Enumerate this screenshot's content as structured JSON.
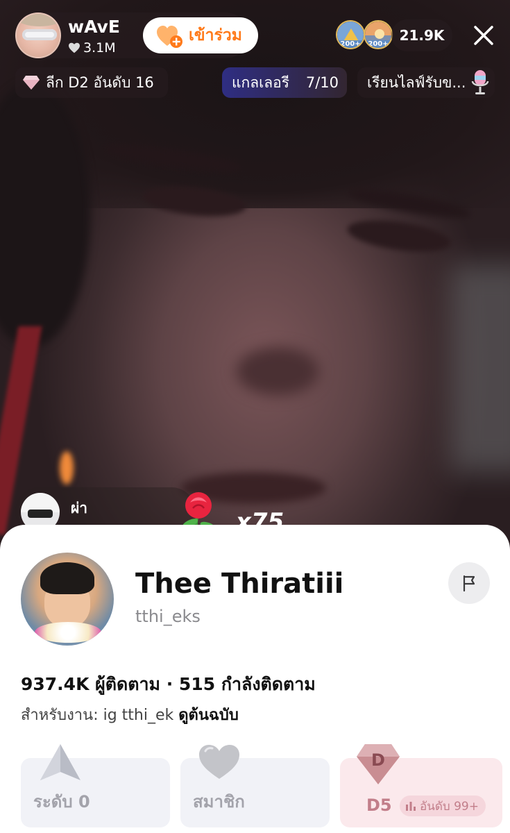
{
  "host": {
    "name": "wAvE",
    "likes": "3.1M",
    "join_label": "เข้าร่วม"
  },
  "viewers": {
    "badges": [
      "200+",
      "200+"
    ],
    "count": "21.9K"
  },
  "chips": {
    "league": "ลีก D2 อันดับ 16",
    "gallery_label": "แกลเลอรี",
    "gallery_count": "7/10",
    "learn": "เรียนไลฟ์รับข..."
  },
  "comment": {
    "name": "ผ่า",
    "combo": "x75"
  },
  "profile": {
    "display_name": "Thee Thiratiii",
    "handle": "tthi_eks",
    "stats": "937.4K ผู้ติดตาม · 515 กำลังติดตาม",
    "bio": "สำหรับงาน: ig tthi_ek",
    "bio_more": "ดูต้นฉบับ",
    "cards": {
      "level": "ระดับ 0",
      "member": "สมาชิก",
      "d5": "D5",
      "rank": "อันดับ 99+"
    }
  },
  "colors": {
    "join_accent": "#ff7a1a",
    "sheet_bg": "#ffffff",
    "d5_card_bg": "#fbe9ec",
    "neutral_card_bg": "#f1f2f7"
  },
  "icons": [
    "heart-icon",
    "heart-plus-icon",
    "close-icon",
    "diamond-icon",
    "microphone-icon",
    "rose-gift-icon",
    "flag-icon",
    "arrow-level-icon",
    "member-heart-icon",
    "d-shield-icon",
    "bar-chart-icon"
  ]
}
